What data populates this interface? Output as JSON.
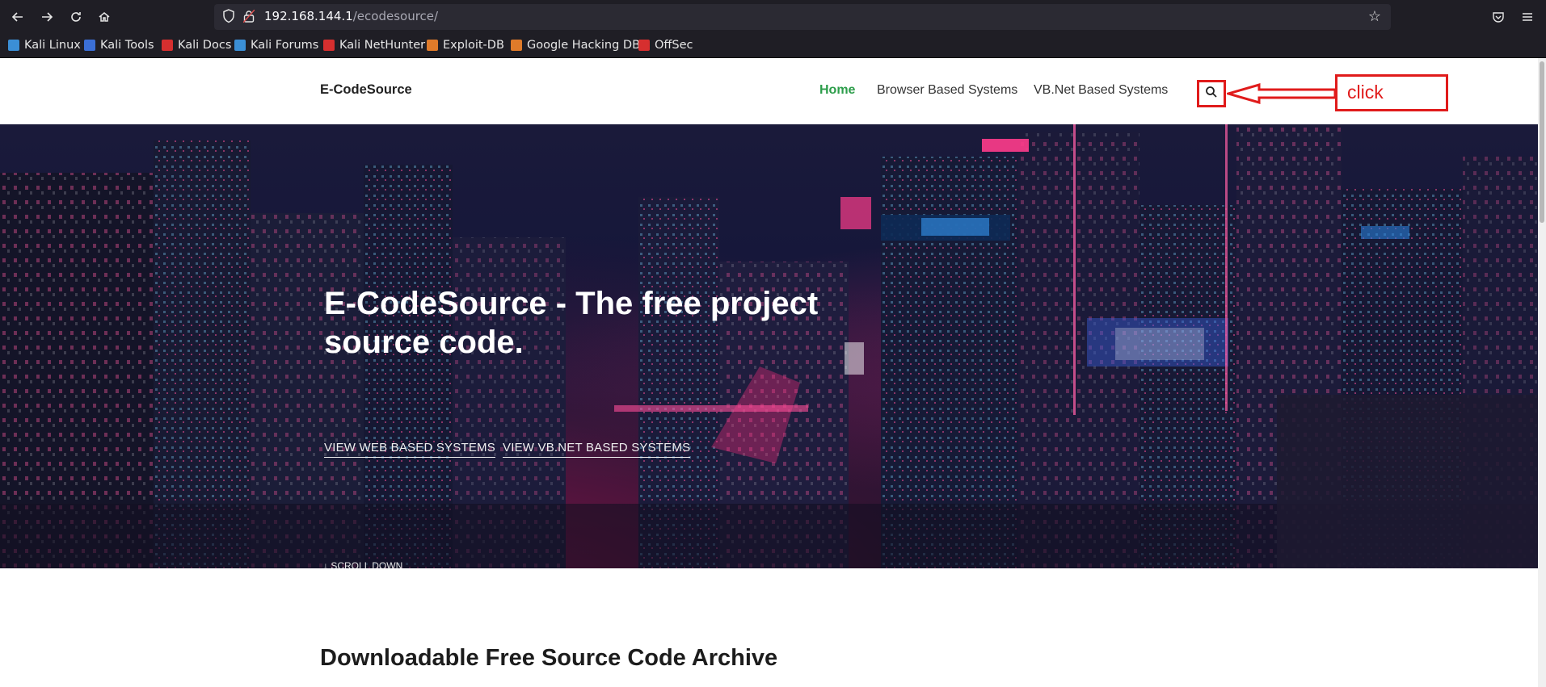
{
  "browser": {
    "url_host": "192.168.144.1",
    "url_path": "/ecodesource/",
    "bookmarks": [
      {
        "label": "Kali Linux",
        "color": "#3b8fd6"
      },
      {
        "label": "Kali Tools",
        "color": "#3b6fd6"
      },
      {
        "label": "Kali Docs",
        "color": "#d62f2f"
      },
      {
        "label": "Kali Forums",
        "color": "#3b8fd6"
      },
      {
        "label": "Kali NetHunter",
        "color": "#d62f2f"
      },
      {
        "label": "Exploit-DB",
        "color": "#e07b2a"
      },
      {
        "label": "Google Hacking DB",
        "color": "#e07b2a"
      },
      {
        "label": "OffSec",
        "color": "#d62f2f"
      }
    ]
  },
  "site": {
    "brand": "E-CodeSource",
    "nav": [
      {
        "label": "Home",
        "active": true
      },
      {
        "label": "Browser Based Systems",
        "active": false
      },
      {
        "label": "VB.Net Based Systems",
        "active": false
      }
    ],
    "annotation": "click"
  },
  "hero": {
    "title": "E-CodeSource - The free project source code.",
    "links": [
      "VIEW WEB BASED SYSTEMS",
      "VIEW VB.NET BASED SYSTEMS"
    ],
    "scroll_down": "SCROLL DOWN",
    "scroll_down_icon": "arrow-down-icon"
  },
  "section": {
    "title": "Downloadable Free Source Code Archive"
  },
  "colors": {
    "accent_green": "#2c9d4a",
    "annotation_red": "#e01b1b",
    "chrome_bg": "#1f1e25"
  }
}
